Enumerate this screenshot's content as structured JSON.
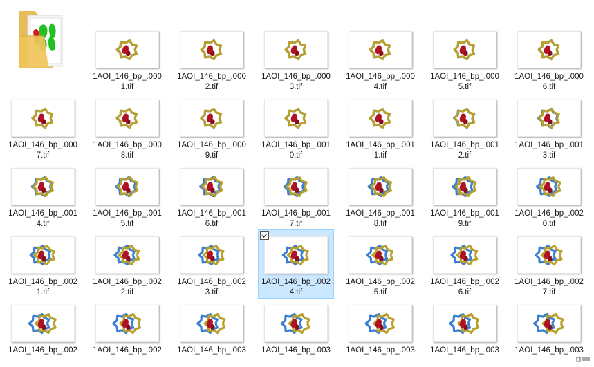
{
  "folder": {
    "name": "",
    "icon": "folder-with-preview-icon"
  },
  "colors": {
    "selection_bg": "#cce8ff",
    "selection_border": "#99d1ff",
    "strand_blue": "#3a7fd0",
    "strand_gold": "#b8a02a",
    "protein_red": "#b01225"
  },
  "files": [
    {
      "line1": "1AOI_146_bp_.000",
      "line2": "1.tif"
    },
    {
      "line1": "1AOI_146_bp_.000",
      "line2": "2.tif"
    },
    {
      "line1": "1AOI_146_bp_.000",
      "line2": "3.tif"
    },
    {
      "line1": "1AOI_146_bp_.000",
      "line2": "4.tif"
    },
    {
      "line1": "1AOI_146_bp_.000",
      "line2": "5.tif"
    },
    {
      "line1": "1AOI_146_bp_.000",
      "line2": "6.tif"
    },
    {
      "line1": "1AOI_146_bp_.000",
      "line2": "7.tif"
    },
    {
      "line1": "1AOI_146_bp_.000",
      "line2": "8.tif"
    },
    {
      "line1": "1AOI_146_bp_.000",
      "line2": "9.tif"
    },
    {
      "line1": "1AOI_146_bp_.001",
      "line2": "0.tif"
    },
    {
      "line1": "1AOI_146_bp_.001",
      "line2": "1.tif"
    },
    {
      "line1": "1AOI_146_bp_.001",
      "line2": "2.tif"
    },
    {
      "line1": "1AOI_146_bp_.001",
      "line2": "3.tif"
    },
    {
      "line1": "1AOI_146_bp_.001",
      "line2": "4.tif"
    },
    {
      "line1": "1AOI_146_bp_.001",
      "line2": "5.tif"
    },
    {
      "line1": "1AOI_146_bp_.001",
      "line2": "6.tif"
    },
    {
      "line1": "1AOI_146_bp_.001",
      "line2": "7.tif"
    },
    {
      "line1": "1AOI_146_bp_.001",
      "line2": "8.tif"
    },
    {
      "line1": "1AOI_146_bp_.001",
      "line2": "9.tif"
    },
    {
      "line1": "1AOI_146_bp_.002",
      "line2": "0.tif"
    },
    {
      "line1": "1AOI_146_bp_.002",
      "line2": "1.tif"
    },
    {
      "line1": "1AOI_146_bp_.002",
      "line2": "2.tif"
    },
    {
      "line1": "1AOI_146_bp_.002",
      "line2": "3.tif"
    },
    {
      "line1": "1AOI_146_bp_.002",
      "line2": "4.tif",
      "selected": true
    },
    {
      "line1": "1AOI_146_bp_.002",
      "line2": "5.tif"
    },
    {
      "line1": "1AOI_146_bp_.002",
      "line2": "6.tif"
    },
    {
      "line1": "1AOI_146_bp_.002",
      "line2": "7.tif"
    },
    {
      "line1": "1AOI_146_bp_.002",
      "line2": ""
    },
    {
      "line1": "1AOI_146_bp_.002",
      "line2": ""
    },
    {
      "line1": "1AOI_146_bp_.003",
      "line2": ""
    },
    {
      "line1": "1AOI_146_bp_.003",
      "line2": ""
    },
    {
      "line1": "1AOI_146_bp_.003",
      "line2": ""
    },
    {
      "line1": "1AOI_146_bp_.003",
      "line2": ""
    },
    {
      "line1": "1AOI_146_bp_.003",
      "line2": ""
    }
  ],
  "status": {
    "view_icon": "view-toggle-icons"
  }
}
